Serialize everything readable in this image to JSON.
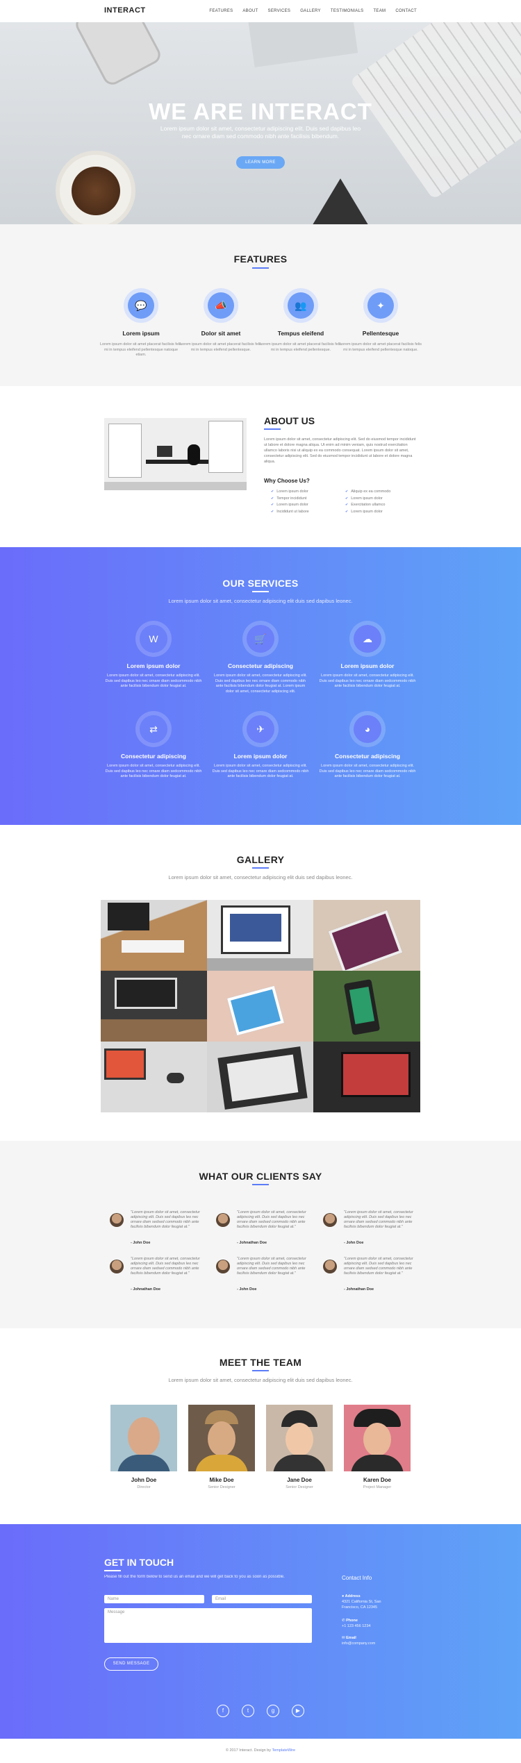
{
  "nav": {
    "brand": "INTERACT",
    "items": [
      "FEATURES",
      "ABOUT",
      "SERVICES",
      "GALLERY",
      "TESTIMONIALS",
      "TEAM",
      "CONTACT"
    ]
  },
  "hero": {
    "title": "WE ARE INTERACT",
    "text": "Lorem ipsum dolor sit amet, consectetur adipiscing elit. Duis sed dapibus leo nec ornare diam sed commodo nibh ante facilisis bibendum.",
    "button": "LEARN MORE"
  },
  "features": {
    "title": "FEATURES",
    "items": [
      {
        "icon": "chat-icon",
        "title": "Lorem ipsum",
        "text": "Lorem ipsum dolor sit amet placerat facilisis felis mi in tempus eleifend pellentesque natoque etiam."
      },
      {
        "icon": "megaphone-icon",
        "title": "Dolor sit amet",
        "text": "Lorem ipsum dolor sit amet placerat facilisis felis mi in tempus eleifend pellentesque."
      },
      {
        "icon": "group-icon",
        "title": "Tempus eleifend",
        "text": "Lorem ipsum dolor sit amet placerat facilisis felis mi in tempus eleifend pellentesque."
      },
      {
        "icon": "magic-wand-icon",
        "title": "Pellentesque",
        "text": "Lorem ipsum dolor sit amet placerat facilisis felis mi in tempus eleifend pellentesque natoque."
      }
    ]
  },
  "about": {
    "title": "ABOUT US",
    "text": "Lorem ipsum dolor sit amet, consectetur adipiscing elit. Sed do eiusmod tempor incididunt ut labore et dolore magna aliqua. Ut enim ad minim veniam, quis nostrud exercitation ullamco laboris nisi ut aliquip ex ea commodo consequat. Lorem ipsum dolor sit amet, consectetur adipiscing elit. Sed do eiusmod tempor incididunt ut labore et dolore magna aliqua.",
    "why_title": "Why Choose Us?",
    "list_left": [
      "Lorem ipsum dolor",
      "Tempor incididunt",
      "Lorem ipsum dolor",
      "Incididunt ut labore"
    ],
    "list_right": [
      "Aliquip ex ea commodo",
      "Lorem ipsum dolor",
      "Exercitation ullamco",
      "Lorem ipsum dolor"
    ]
  },
  "services": {
    "title": "OUR SERVICES",
    "subtitle": "Lorem ipsum dolor sit amet, consectetur adipiscing elit duis sed dapibus leonec.",
    "items": [
      {
        "icon": "wordpress-icon",
        "title": "Lorem ipsum dolor",
        "text": "Lorem ipsum dolor sit amet, consectetur adipiscing elit. Duis sed dapibus leo nec ornare diam sedcommodo nibh ante facilisis bibendum dolor feugiat at."
      },
      {
        "icon": "cart-icon",
        "title": "Consectetur adipiscing",
        "text": "Lorem ipsum dolor sit amet, consectetur adipiscing elit. Duis sed dapibus leo nec ornare diam commodo nibh ante facilisis bibendum dolor feugiat at. Lorem ipsum dolor sit amet, consectetur adipiscing elit."
      },
      {
        "icon": "cloud-download-icon",
        "title": "Lorem ipsum dolor",
        "text": "Lorem ipsum dolor sit amet, consectetur adipiscing elit. Duis sed dapibus leo nec ornare diam sedcommodo nibh ante facilisis bibendum dolor feugiat at."
      },
      {
        "icon": "translate-icon",
        "title": "Consectetur adipiscing",
        "text": "Lorem ipsum dolor sit amet, consectetur adipiscing elit. Duis sed dapibus leo nec ornare diam sedcommodo nibh ante facilisis bibendum dolor feugiat at."
      },
      {
        "icon": "airplane-icon",
        "title": "Lorem ipsum dolor",
        "text": "Lorem ipsum dolor sit amet, consectetur adipiscing elit. Duis sed dapibus leo nec ornare diam sedcommodo nibh ante facilisis bibendum dolor feugiat at."
      },
      {
        "icon": "pie-chart-icon",
        "title": "Consectetur adipiscing",
        "text": "Lorem ipsum dolor sit amet, consectetur adipiscing elit. Duis sed dapibus leo nec ornare diam sedcommodo nibh ante facilisis bibendum dolor feugiat at."
      }
    ]
  },
  "gallery": {
    "title": "GALLERY",
    "subtitle": "Lorem ipsum dolor sit amet, consectetur adipiscing elit duis sed dapibus leonec."
  },
  "testimonials": {
    "title": "WHAT OUR CLIENTS SAY",
    "items": [
      {
        "quote": "\"Lorem ipsum dolor sit amet, consectetur adipiscing elit. Duis sed dapibus leo nec ornare diam sedsed commodo nibh ante facilisis bibendum dolor feugiat at.\"",
        "name": "- John Doe"
      },
      {
        "quote": "\"Lorem ipsum dolor sit amet, consectetur adipiscing elit. Duis sed dapibus leo nec ornare diam sedsed commodo nibh ante facilisis bibendum dolor feugiat at.\"",
        "name": "- Johnathan Doe"
      },
      {
        "quote": "\"Lorem ipsum dolor sit amet, consectetur adipiscing elit. Duis sed dapibus leo nec ornare diam sedsed commodo nibh ante facilisis bibendum dolor feugiat at.\"",
        "name": "- John Doe"
      },
      {
        "quote": "\"Lorem ipsum dolor sit amet, consectetur adipiscing elit. Duis sed dapibus leo nec ornare diam sedsed commodo nibh ante facilisis bibendum dolor feugiat at.\"",
        "name": "- Johnathan Doe"
      },
      {
        "quote": "\"Lorem ipsum dolor sit amet, consectetur adipiscing elit. Duis sed dapibus leo nec ornare diam sedsed commodo nibh ante facilisis bibendum dolor feugiat at.\"",
        "name": "- John Doe"
      },
      {
        "quote": "\"Lorem ipsum dolor sit amet, consectetur adipiscing elit. Duis sed dapibus leo nec ornare diam sedsed commodo nibh ante facilisis bibendum dolor feugiat at.\"",
        "name": "- Johnathan Doe"
      }
    ]
  },
  "team": {
    "title": "MEET THE TEAM",
    "subtitle": "Lorem ipsum dolor sit amet, consectetur adipiscing elit duis sed dapibus leonec.",
    "members": [
      {
        "name": "John Doe",
        "role": "Director"
      },
      {
        "name": "Mike Doe",
        "role": "Senior Designer"
      },
      {
        "name": "Jane Doe",
        "role": "Senior Designer"
      },
      {
        "name": "Karen Doe",
        "role": "Project Manager"
      }
    ]
  },
  "contact": {
    "title": "GET IN TOUCH",
    "lead": "Please fill out the form below to send us an email and we will get back to you as soon as possible.",
    "name_ph": "Name",
    "email_ph": "Email",
    "message_ph": "Message",
    "button": "SEND MESSAGE",
    "info_title": "Contact Info",
    "address_label": "Address",
    "address": "4321 California St, San Francisco, CA 12345",
    "phone_label": "Phone",
    "phone": "+1 123 456 1234",
    "email_label": "Email",
    "email": "info@company.com"
  },
  "footer": {
    "text": "© 2017 Interact. Design by",
    "link": "TemplateWire"
  },
  "colors": {
    "accent": "#5b7cf8",
    "gradient_start": "#6a6cfa",
    "gradient_end": "#5ea3f7"
  }
}
